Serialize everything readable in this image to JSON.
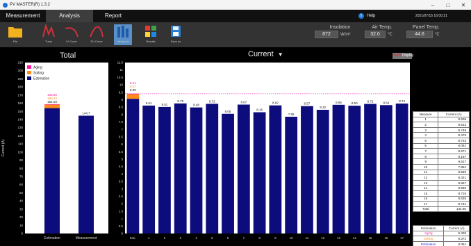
{
  "window": {
    "title": "PV MASTER(R) 1.3.2",
    "controls": [
      "–",
      "□",
      "✕"
    ]
  },
  "menu": {
    "tabs": [
      "Measurement",
      "Analysis",
      "Report"
    ],
    "active_tab": "Analysis",
    "help": "Help",
    "datetime": "2021/07/15 16:00:21"
  },
  "toolbar": {
    "tools": [
      {
        "label": "File",
        "icon": "folder-icon"
      },
      {
        "label": "Trans",
        "icon": "trans-curve-icon"
      },
      {
        "label": "IV Curve",
        "icon": "iv-curve-icon"
      },
      {
        "label": "PV Curve",
        "icon": "pv-curve-icon"
      },
      {
        "label": "Histogram",
        "icon": "histogram-icon"
      },
      {
        "label": "Results",
        "icon": "results-grid-icon"
      },
      {
        "label": "Save as",
        "icon": "save-icon"
      }
    ],
    "selected_tool": "Histogram",
    "meters": [
      {
        "label": "Insolation",
        "value": "872",
        "unit": "W/m²"
      },
      {
        "label": "Air Temp.",
        "value": "32.0",
        "unit": "℃"
      },
      {
        "label": "Panel Temp.",
        "value": "44.6",
        "unit": "℃"
      }
    ]
  },
  "total_panel": {
    "title": "Total"
  },
  "current_panel": {
    "title": "Current",
    "display_button": {
      "prefix": "Select",
      "label": "Display"
    }
  },
  "colors": {
    "estimation": "#0c0c7c",
    "soiling": "#ff8c1a",
    "aging": "#ff1aa0",
    "dotted_line": "#ff66cc"
  },
  "chart_data": [
    {
      "type": "bar",
      "title": "Total",
      "ylabel": "Current (A)",
      "ylim": [
        0,
        210
      ],
      "yticks": [
        0,
        10,
        20,
        30,
        40,
        50,
        60,
        70,
        80,
        90,
        100,
        110,
        120,
        130,
        140,
        150,
        160,
        170,
        180,
        190,
        200,
        210
      ],
      "categories": [
        "Estimation",
        "Measurement"
      ],
      "legend": [
        "Aging",
        "Soiling",
        "Estimation"
      ],
      "legend_placement": "top-left",
      "series": [
        {
          "name": "Estimation",
          "values": [
            154.03,
            144.7
          ]
        },
        {
          "name": "Soiling",
          "values": [
            4.24,
            0
          ]
        },
        {
          "name": "Aging",
          "values": [
            0.6,
            0
          ]
        }
      ],
      "labels": [
        [
          "155.89",
          "158.23",
          "154.03"
        ],
        [
          "144.7"
        ]
      ]
    },
    {
      "type": "bar",
      "title": "Current",
      "ylim": [
        0,
        11.5
      ],
      "yticks": [
        "0",
        "0.5",
        "1",
        "1.5",
        "2",
        "2.5",
        "3",
        "3.5",
        "4",
        "4.5",
        "5",
        "5.5",
        "6",
        "6.5",
        "7",
        "7.5",
        "8",
        "8.5",
        "9",
        "9.5",
        "10",
        "10.5",
        "11",
        "11.5"
      ],
      "categories": [
        "Estimation",
        "1",
        "2",
        "3",
        "4",
        "5",
        "6",
        "7",
        "8",
        "9",
        "10",
        "11",
        "12",
        "13",
        "14",
        "15",
        "16",
        "17"
      ],
      "values": [
        9.061,
        8.606,
        8.513,
        8.749,
        8.479,
        8.723,
        8.051,
        8.671,
        8.157,
        8.617,
        7.854,
        8.569,
        8.321,
        8.657,
        8.596,
        8.716,
        8.635,
        8.741
      ],
      "bar_labels": [
        "9.00",
        "8.61",
        "8.51",
        "8.75",
        "8.48",
        "8.72",
        "8.05",
        "8.67",
        "8.16",
        "8.62",
        "7.85",
        "8.57",
        "8.32",
        "8.66",
        "8.60",
        "8.72",
        "8.64",
        "8.74"
      ],
      "estimation_stack": {
        "soiling": 0.311,
        "aging": 0.033
      },
      "estimation_labels": [
        "9.41",
        "9.37",
        "9.00"
      ],
      "reference_line": 9.405
    }
  ],
  "measure_table": {
    "headers": [
      "Measure",
      "Current (A)"
    ],
    "rows": [
      [
        "1",
        "8.606"
      ],
      [
        "2",
        "8.513"
      ],
      [
        "3",
        "8.749"
      ],
      [
        "4",
        "8.479"
      ],
      [
        "5",
        "8.723"
      ],
      [
        "6",
        "8.051"
      ],
      [
        "7",
        "8.671"
      ],
      [
        "8",
        "8.157"
      ],
      [
        "9",
        "8.617"
      ],
      [
        "10",
        "7.854"
      ],
      [
        "11",
        "8.569"
      ],
      [
        "12",
        "8.321"
      ],
      [
        "13",
        "8.657"
      ],
      [
        "14",
        "8.596"
      ],
      [
        "15",
        "8.716"
      ],
      [
        "16",
        "8.635"
      ],
      [
        "17",
        "8.741"
      ],
      [
        "Total",
        "144.66"
      ]
    ]
  },
  "estimation_table": {
    "headers": [
      "Estimation",
      "Current (A)"
    ],
    "rows": [
      [
        "Aging",
        "9.405"
      ],
      [
        "Soiling",
        "9.372"
      ],
      [
        "Estimation",
        "9.061"
      ],
      [
        "Total Estimation",
        "154.03"
      ]
    ]
  }
}
